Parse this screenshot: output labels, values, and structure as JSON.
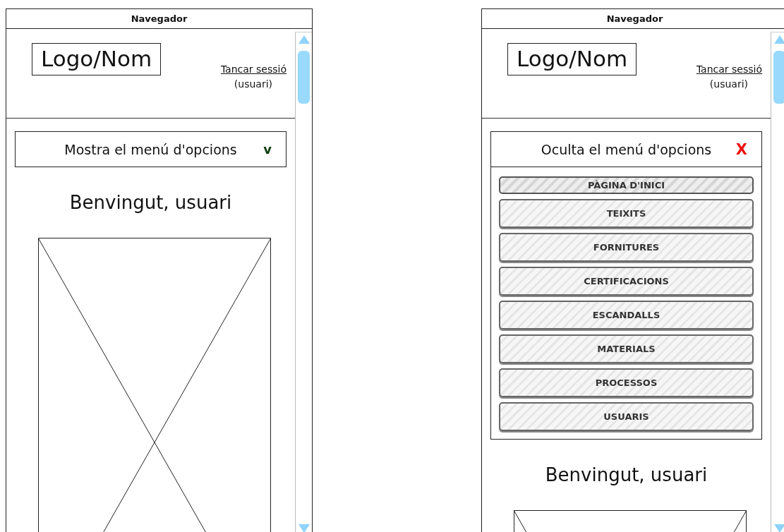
{
  "frames": [
    {
      "title": "Navegador",
      "logo": "Logo/Nom",
      "logout_link": "Tancar sessió",
      "user": "(usuari)",
      "menu_toggle": {
        "label": "Mostra el menú d'opcions",
        "icon": "v",
        "expanded": false
      },
      "welcome": "Benvingut, usuari"
    },
    {
      "title": "Navegador",
      "logo": "Logo/Nom",
      "logout_link": "Tancar sessió",
      "user": "(usuari)",
      "menu_toggle": {
        "label": "Oculta el menú d'opcions",
        "icon": "X",
        "expanded": true
      },
      "menu_items": [
        {
          "label": "PÀGINA D'INICI",
          "selected": true
        },
        {
          "label": "TEIXITS",
          "selected": false
        },
        {
          "label": "FORNITURES",
          "selected": false
        },
        {
          "label": "CERTIFICACIONS",
          "selected": false
        },
        {
          "label": "ESCANDALLS",
          "selected": false
        },
        {
          "label": "MATERIALS",
          "selected": false
        },
        {
          "label": "PROCESSOS",
          "selected": false
        },
        {
          "label": "USUARIS",
          "selected": false
        }
      ],
      "welcome": "Benvingut, usuari"
    }
  ]
}
